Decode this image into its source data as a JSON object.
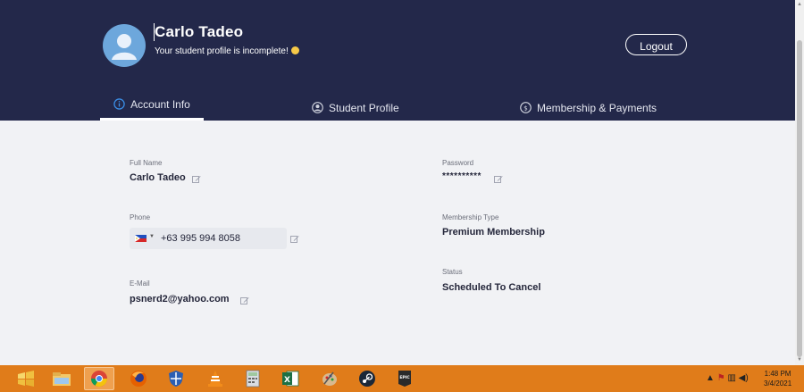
{
  "header": {
    "user_name": "Carlo Tadeo",
    "subtitle": "Your student profile is incomplete!",
    "logout_label": "Logout"
  },
  "tabs": [
    {
      "label": "Account Info",
      "icon": "info-icon",
      "active": true
    },
    {
      "label": "Student Profile",
      "icon": "user-circle-icon",
      "active": false
    },
    {
      "label": "Membership & Payments",
      "icon": "dollar-circle-icon",
      "active": false
    }
  ],
  "account": {
    "full_name_label": "Full Name",
    "full_name": "Carlo Tadeo",
    "phone_label": "Phone",
    "phone": "+63 995 994 8058",
    "phone_country": "PH",
    "email_label": "E-Mail",
    "email": "psnerd2@yahoo.com",
    "password_label": "Password",
    "password": "**********",
    "membership_label": "Membership Type",
    "membership": "Premium Membership",
    "status_label": "Status",
    "status": "Scheduled To Cancel"
  },
  "taskbar": {
    "apps": [
      "start-icon",
      "file-explorer-icon",
      "chrome-icon",
      "firefox-icon",
      "shield-icon",
      "vlc-icon",
      "calculator-icon",
      "excel-icon",
      "paint-icon",
      "steam-icon",
      "epic-games-icon"
    ],
    "time": "1:48 PM",
    "date": "3/4/2021"
  },
  "colors": {
    "header_bg": "#23284a",
    "accent_tab_icon": "#3a8ee6",
    "taskbar": "#e07c1a"
  }
}
